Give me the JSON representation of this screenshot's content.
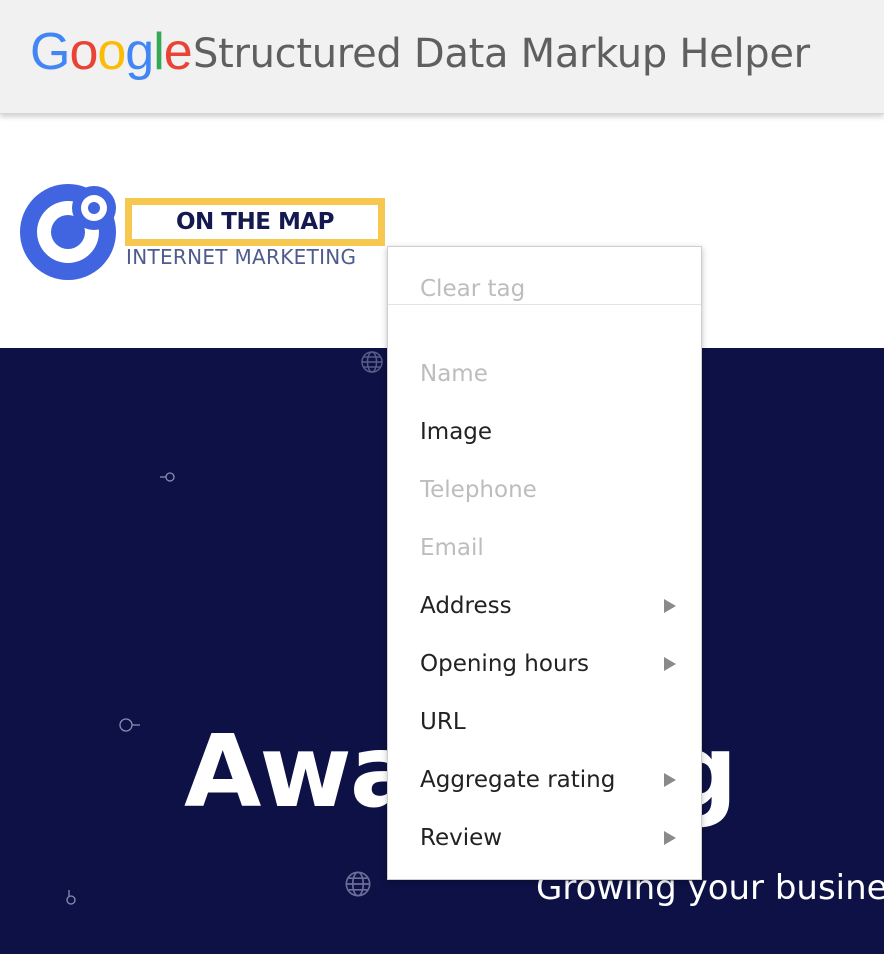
{
  "header": {
    "logo_letters": [
      {
        "char": "G",
        "color": "#4285F4"
      },
      {
        "char": "o",
        "color": "#EA4335"
      },
      {
        "char": "o",
        "color": "#FBBC05"
      },
      {
        "char": "g",
        "color": "#4285F4"
      },
      {
        "char": "l",
        "color": "#34A853"
      },
      {
        "char": "e",
        "color": "#EA4335"
      }
    ],
    "title": "Structured Data Markup Helper"
  },
  "site": {
    "logo_name": "ON THE MAP",
    "logo_subtitle": "INTERNET MARKETING",
    "hero_heading": "Awar        ning",
    "hero_subtext": "Growing your busine",
    "colors": {
      "logo_blue": "#4164e0",
      "logo_yellow": "#f6c850",
      "hero_bg": "#0d1145"
    }
  },
  "context_menu": {
    "clear_label": "Clear tag",
    "items": [
      {
        "label": "Name",
        "disabled": true,
        "submenu": false
      },
      {
        "label": "Image",
        "disabled": false,
        "submenu": false
      },
      {
        "label": "Telephone",
        "disabled": true,
        "submenu": false
      },
      {
        "label": "Email",
        "disabled": true,
        "submenu": false
      },
      {
        "label": "Address",
        "disabled": false,
        "submenu": true
      },
      {
        "label": "Opening hours",
        "disabled": false,
        "submenu": true
      },
      {
        "label": "URL",
        "disabled": false,
        "submenu": false
      },
      {
        "label": "Aggregate rating",
        "disabled": false,
        "submenu": true
      },
      {
        "label": "Review",
        "disabled": false,
        "submenu": true
      }
    ]
  }
}
